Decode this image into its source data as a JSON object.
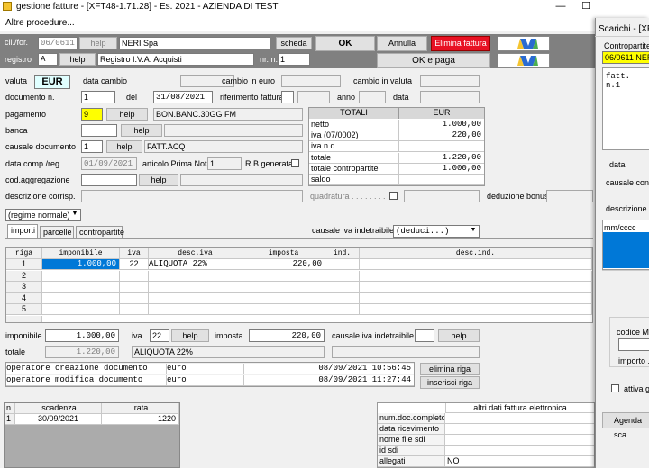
{
  "window": {
    "title": "gestione fatture - [XFT48-1.71.28] - Es. 2021 - AZIENDA DI TEST",
    "minimize": "—",
    "maximize": "☐",
    "menu": "Altre procedure..."
  },
  "header": {
    "cli_label": "cli./for.",
    "cli_code": "06/0611",
    "help1": "help",
    "cli_name": "NERI Spa",
    "scheda": "scheda",
    "ok": "OK",
    "annulla": "Annulla",
    "elimina": "Elimina fattura",
    "registro_label": "registro",
    "registro_code": "A",
    "help2": "help",
    "registro_name": "Registro I.V.A. Acquisti",
    "nr_label": "nr. n.",
    "nr_value": "1",
    "ok_paga": "OK e paga"
  },
  "form": {
    "valuta_label": "valuta",
    "valuta": "EUR",
    "data_cambio_label": "data cambio",
    "cambio_euro_label": "cambio in euro",
    "cambio_valuta_label": "cambio in valuta",
    "documento_label": "documento n.",
    "documento": "1",
    "del_label": "del",
    "del": "31/08/2021",
    "rif_label": "riferimento fattura",
    "anno_label": "anno",
    "data_label": "data",
    "pagamento_label": "pagamento",
    "pagamento_code": "9",
    "help_pag": "help",
    "pagamento_desc": "BON.BANC.30GG FM",
    "banca_label": "banca",
    "help_banca": "help",
    "causale_label": "causale documento",
    "causale_code": "1",
    "help_caus": "help",
    "causale_desc": "FATT.ACQ",
    "data_comp_label": "data comp./reg.",
    "data_comp": "01/09/2021",
    "art_pn_label": "articolo Prima Nota",
    "art_pn": "1",
    "rb_label": "R.B.generata",
    "cod_agg_label": "cod.aggregazione",
    "help_agg": "help",
    "descr_label": "descrizione corrisp.",
    "quadratura_label": "quadratura . . . . . . . .",
    "deduzione_label": "deduzione bonus",
    "regime": "(regime normale)",
    "causale_iva_label": "causale iva indetraibile",
    "causale_iva": "(deduci...)"
  },
  "totals": {
    "header_left": "TOTALI",
    "header_right": "EUR",
    "rows": [
      {
        "label": "netto",
        "value": "1.000,00"
      },
      {
        "label": "iva (07/0002)",
        "value": "220,00"
      },
      {
        "label": "iva n.d.",
        "value": ""
      },
      {
        "label": "totale",
        "value": "1.220,00"
      },
      {
        "label": "totale contropartite",
        "value": "1.000,00"
      },
      {
        "label": "saldo",
        "value": ""
      }
    ]
  },
  "tabs": [
    "importi",
    "parcelle",
    "contropartite"
  ],
  "grid": {
    "headers": [
      "riga",
      "imponibile",
      "iva",
      "desc.iva",
      "imposta",
      "ind.",
      "desc.ind."
    ],
    "rows": [
      {
        "riga": "1",
        "imponibile": "1.000,00",
        "iva": "22",
        "desc": "ALIQUOTA 22%",
        "imposta": "220,00"
      },
      {
        "riga": "2",
        "imponibile": "",
        "iva": "",
        "desc": "",
        "imposta": ""
      },
      {
        "riga": "3",
        "imponibile": "",
        "iva": "",
        "desc": "",
        "imposta": ""
      },
      {
        "riga": "4",
        "imponibile": "",
        "iva": "",
        "desc": "",
        "imposta": ""
      },
      {
        "riga": "5",
        "imponibile": "",
        "iva": "",
        "desc": "",
        "imposta": ""
      }
    ]
  },
  "row_edit": {
    "imponibile_label": "imponibile",
    "imponibile": "1.000,00",
    "iva_label": "iva",
    "iva": "22",
    "help_iva": "help",
    "imposta_label": "imposta",
    "imposta": "220,00",
    "causale_ind_label": "causale iva indetraibile",
    "help_ind": "help",
    "totale_label": "totale",
    "totale": "1.220,00",
    "aliquota": "ALIQUOTA 22%"
  },
  "operators": [
    {
      "label": "operatore creazione documento",
      "currency": "euro",
      "when": "08/09/2021 10:56:45"
    },
    {
      "label": "operatore modifica documento",
      "currency": "euro",
      "when": "08/09/2021 11:27:44"
    }
  ],
  "elimina_riga": "elimina riga",
  "inserisci_riga": "inserisci riga",
  "scadenze": {
    "headers": [
      "n.",
      "scadenza",
      "rata"
    ],
    "rows": [
      {
        "n": "1",
        "scadenza": "30/09/2021",
        "rata": "1220"
      }
    ]
  },
  "fattura_el": {
    "header": "altri dati fattura elettronica",
    "rows": [
      {
        "label": "num.doc.completo",
        "value": ""
      },
      {
        "label": "data ricevimento",
        "value": ""
      },
      {
        "label": "nome file sdi",
        "value": ""
      },
      {
        "label": "id sdi",
        "value": ""
      },
      {
        "label": "allegati",
        "value": "NO"
      }
    ]
  },
  "side": {
    "title": "Scarichi - [XF",
    "contropartite": "Contropartite",
    "code": "06/0611 NER",
    "fatt": "fatt. n.1",
    "data": "data",
    "causale": "causale conta",
    "descrizione": "descrizione",
    "list_head": "mm/cccc",
    "codice": "codice MM",
    "importo": "importo .",
    "attiva": "attiva ge",
    "agenda": "Agenda sca"
  }
}
